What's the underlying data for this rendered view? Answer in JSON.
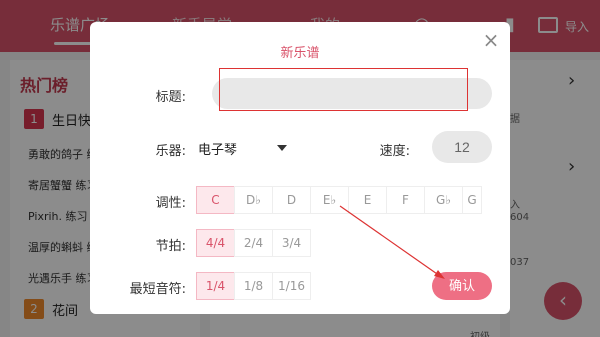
{
  "header": {
    "tabs": [
      "乐谱广场",
      "新手导学",
      "我的"
    ],
    "import_label": "导入"
  },
  "background": {
    "hot_title": "热门榜",
    "rank1": {
      "num": "1",
      "name": "生日快"
    },
    "rank2": {
      "num": "2",
      "name": "花间"
    },
    "songs": [
      "勇敢的鸽子 练",
      "寄居蟹蟹 练习",
      "Pixrih. 练习",
      "温厚的蝌蚪 练",
      "光遇乐手 练习"
    ],
    "right_texts": [
      "据",
      "入",
      "604",
      "037",
      "初级"
    ]
  },
  "dialog": {
    "title": "新乐谱",
    "title_label": "标题:",
    "title_value": "",
    "instrument_label": "乐器:",
    "instrument_value": "电子琴",
    "speed_label": "速度:",
    "speed_value": "12",
    "key_label": "调性:",
    "keys": [
      "C",
      "D♭",
      "D",
      "E♭",
      "E",
      "F",
      "G♭",
      "G"
    ],
    "key_selected": "C",
    "beat_label": "节拍:",
    "beats": [
      "4/4",
      "2/4",
      "3/4"
    ],
    "beat_selected": "4/4",
    "note_label": "最短音符:",
    "notes": [
      "1/4",
      "1/8",
      "1/16"
    ],
    "note_selected": "1/4",
    "confirm_label": "确认"
  },
  "colors": {
    "accent": "#d9536a",
    "annotation": "#d33"
  }
}
